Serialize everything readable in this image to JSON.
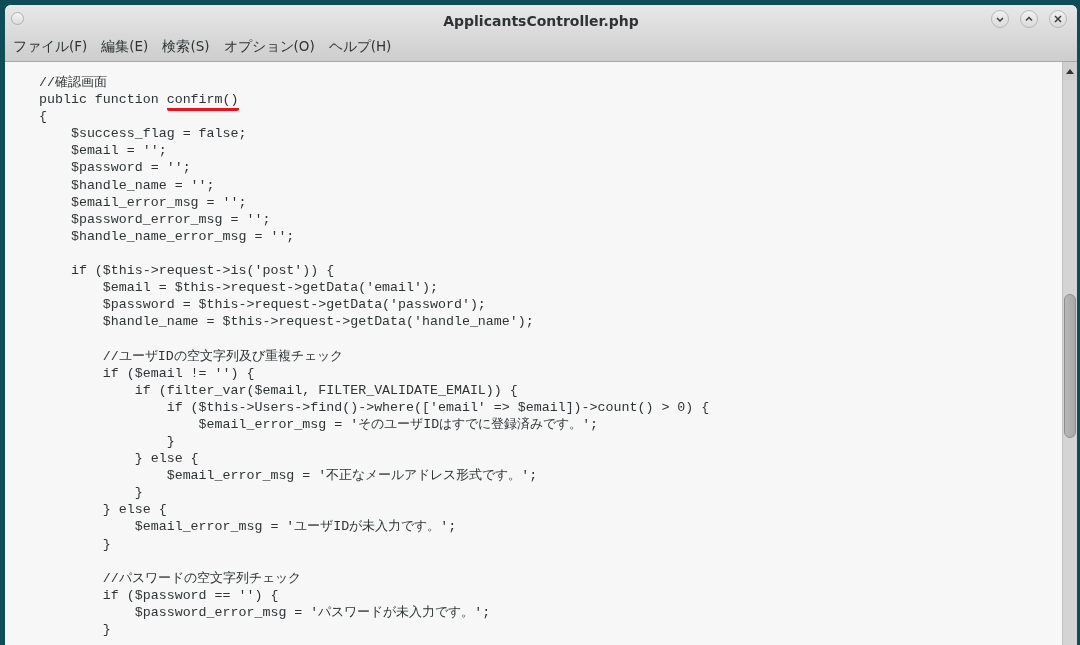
{
  "window": {
    "title": "ApplicantsController.php"
  },
  "menu": [
    {
      "label": "ファイル(F)"
    },
    {
      "label": "編集(E)"
    },
    {
      "label": "検索(S)"
    },
    {
      "label": "オプション(O)"
    },
    {
      "label": "ヘルプ(H)"
    }
  ],
  "code_blocks": [
    [
      "//確認画面",
      {
        "kind": "underlined",
        "text": "public function ",
        "underlined": "confirm()"
      },
      "{",
      "    $success_flag = false;",
      "    $email = '';",
      "    $password = '';",
      "    $handle_name = '';",
      "    $email_error_msg = '';",
      "    $password_error_msg = '';",
      "    $handle_name_error_msg = '';"
    ],
    [
      "    if ($this->request->is('post')) {",
      "        $email = $this->request->getData('email');",
      "        $password = $this->request->getData('password');",
      "        $handle_name = $this->request->getData('handle_name');"
    ],
    [
      "        //ユーザIDの空文字列及び重複チェック",
      "        if ($email != '') {",
      "            if (filter_var($email, FILTER_VALIDATE_EMAIL)) {",
      "                if ($this->Users->find()->where(['email' => $email])->count() > 0) {",
      "                    $email_error_msg = 'そのユーザIDはすでに登録済みです。';",
      "                }",
      "            } else {",
      "                $email_error_msg = '不正なメールアドレス形式です。';",
      "            }",
      "        } else {",
      "            $email_error_msg = 'ユーザIDが未入力です。';",
      "        }"
    ],
    [
      "        //パスワードの空文字列チェック",
      "        if ($password == '') {",
      "            $password_error_msg = 'パスワードが未入力です。';",
      "        }"
    ]
  ]
}
